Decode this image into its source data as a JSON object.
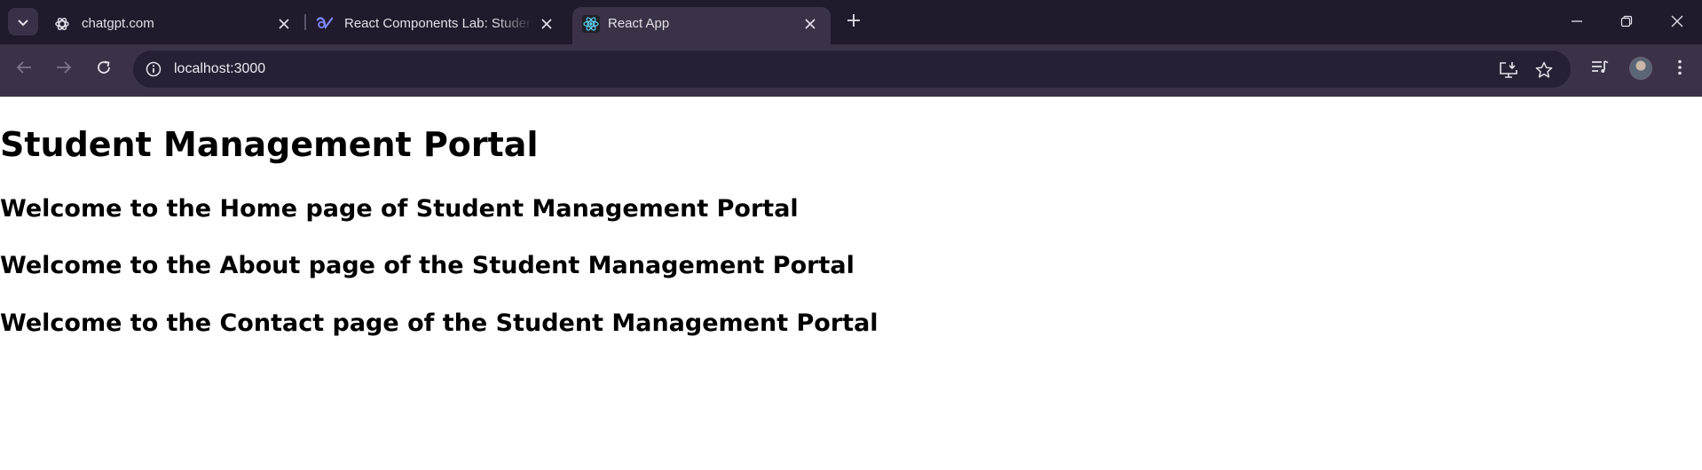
{
  "browser": {
    "tabs": [
      {
        "title": "chatgpt.com",
        "icon": "openai-icon"
      },
      {
        "title": "React Components Lab: Student",
        "icon": "lab-icon"
      },
      {
        "title": "React App",
        "icon": "react-icon",
        "active": true
      }
    ],
    "url": "localhost:3000"
  },
  "page": {
    "title": "Student Management Portal",
    "sections": [
      "Welcome to the Home page of Student Management Portal",
      "Welcome to the About page of the Student Management Portal",
      "Welcome to the Contact page of the Student Management Portal"
    ]
  },
  "colors": {
    "tabstrip": "#211a2c",
    "toolbar": "#3b3247",
    "omnibox": "#271f33",
    "react_logo": "#61dafb"
  }
}
